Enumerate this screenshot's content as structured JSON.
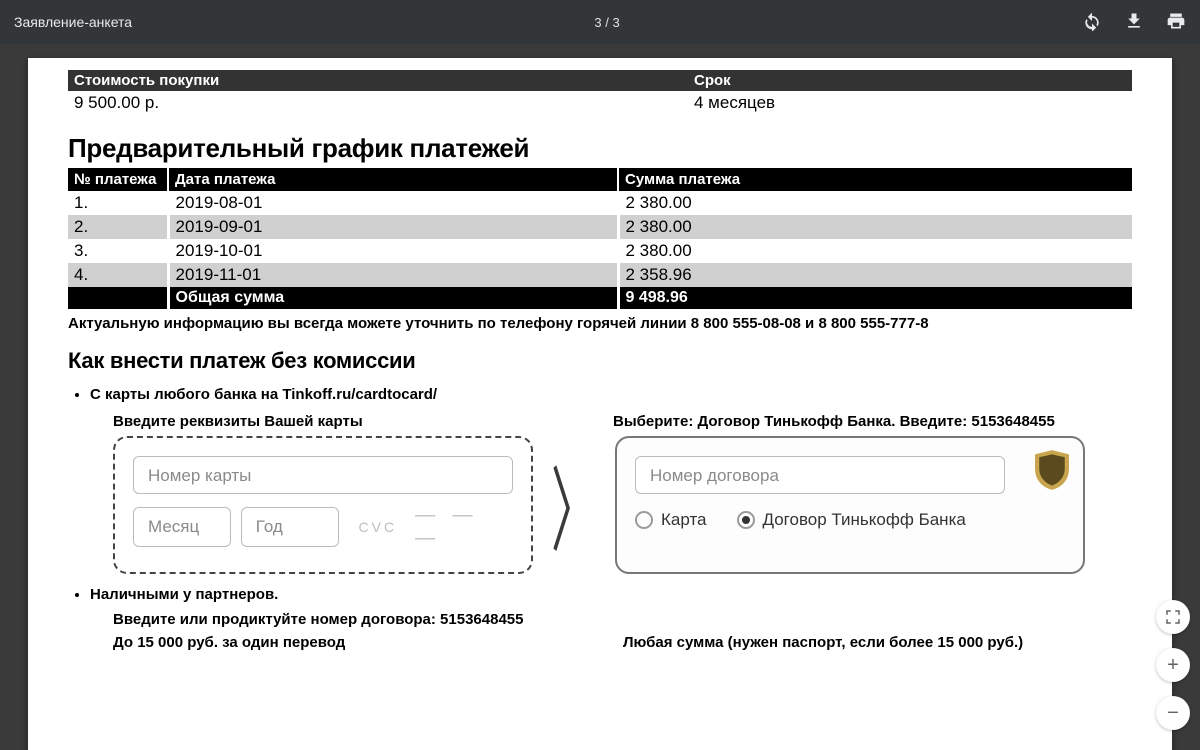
{
  "toolbar": {
    "title": "Заявление-анкета",
    "page_indicator": "3 / 3"
  },
  "purchase": {
    "price_label": "Стоимость покупки",
    "term_label": "Срок",
    "price_value": "9 500.00 р.",
    "term_value": "4 месяцев"
  },
  "schedule": {
    "title": "Предварительный график платежей",
    "col_no": "№ платежа",
    "col_date": "Дата платежа",
    "col_sum": "Сумма платежа",
    "rows": [
      {
        "no": "1.",
        "date": "2019-08-01",
        "sum": "2 380.00"
      },
      {
        "no": "2.",
        "date": "2019-09-01",
        "sum": "2 380.00"
      },
      {
        "no": "3.",
        "date": "2019-10-01",
        "sum": "2 380.00"
      },
      {
        "no": "4.",
        "date": "2019-11-01",
        "sum": "2 358.96"
      }
    ],
    "total_label": "Общая сумма",
    "total_value": "9 498.96"
  },
  "hotline": "Актуальную информацию вы всегда можете уточнить по телефону горячей линии 8 800 555-08-08 и 8 800 555-777-8",
  "howto": {
    "title": "Как внести платеж без комиссии",
    "bullet1": "С карты любого банка на Tinkoff.ru/cardtocard/",
    "bullet2": "Наличными у партнеров."
  },
  "cardform": {
    "left_label": "Введите реквизиты Вашей карты",
    "right_label": "Выберите: Договор Тинькофф Банка. Введите: 5153648455",
    "card_number_ph": "Номер карты",
    "month_ph": "Месяц",
    "year_ph": "Год",
    "cvc_label": "CVC",
    "contract_number_ph": "Номер договора",
    "radio_card": "Карта",
    "radio_contract": "Договор Тинькофф Банка"
  },
  "partners": {
    "contract_line": "Введите или продиктуйте номер договора: 5153648455",
    "limit_left": "До 15 000 руб. за один перевод",
    "limit_right": "Любая сумма (нужен паспорт, если более 15 000 руб.)"
  }
}
